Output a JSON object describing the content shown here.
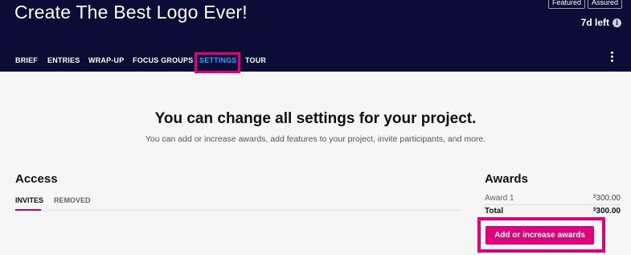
{
  "header": {
    "title": "Create The Best Logo Ever!",
    "badges": [
      "Featured",
      "Assured"
    ],
    "time_left": "7d left",
    "tabs": [
      {
        "label": "BRIEF"
      },
      {
        "label": "ENTRIES"
      },
      {
        "label": "WRAP-UP"
      },
      {
        "label": "FOCUS GROUPS"
      },
      {
        "label": "SETTINGS",
        "active": true
      },
      {
        "label": "TOUR"
      }
    ],
    "colors": {
      "background": "#0b0d36",
      "active_tab": "#1ca3ff",
      "highlight": "#e0007a"
    }
  },
  "main": {
    "heading": "You can change all settings for your project.",
    "subheading": "You can add or increase awards, add features to your project, invite participants, and more."
  },
  "access": {
    "title": "Access",
    "tabs": [
      {
        "label": "INVITES",
        "active": true
      },
      {
        "label": "REMOVED"
      }
    ]
  },
  "awards": {
    "title": "Awards",
    "rows": [
      {
        "label": "Award 1",
        "currency": "$",
        "amount": "300.00"
      },
      {
        "label": "Total",
        "currency": "$",
        "amount": "300.00"
      }
    ],
    "button_label": "Add or increase awards",
    "button_color": "#e0007a"
  }
}
